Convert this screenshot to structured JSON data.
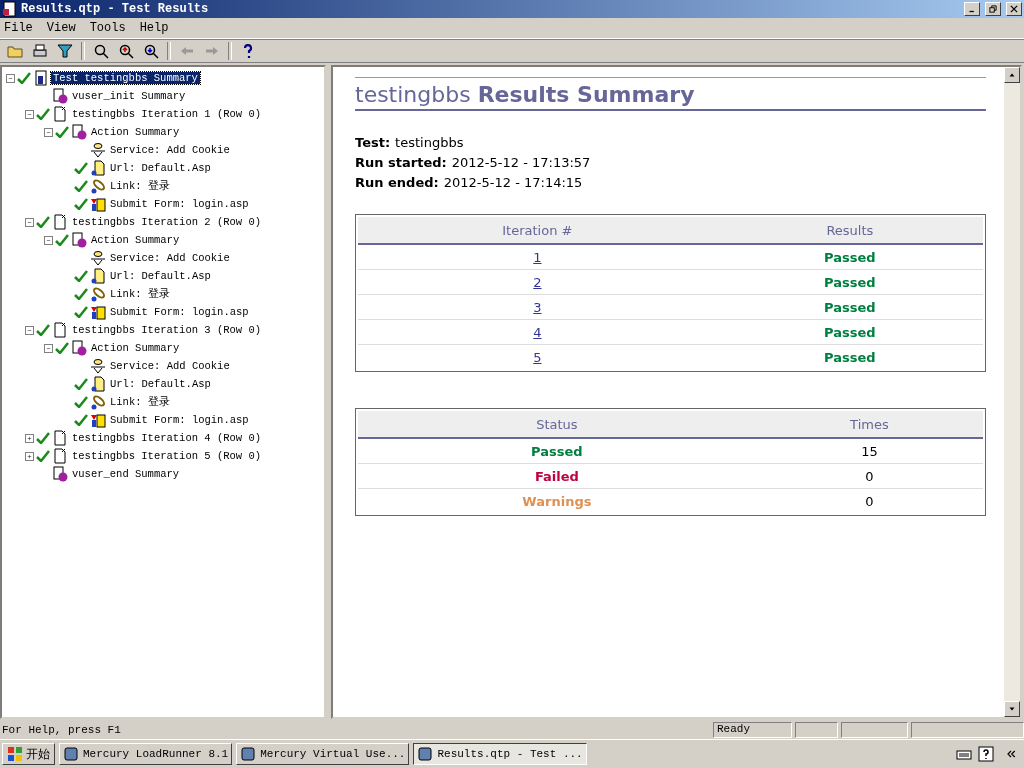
{
  "window": {
    "title": "Results.qtp - Test Results"
  },
  "menu": [
    "File",
    "View",
    "Tools",
    "Help"
  ],
  "tree": [
    {
      "label": "Test testingbbs Summary",
      "kind": "test",
      "passed": true,
      "selected": true,
      "expanded": true,
      "children": [
        {
          "label": "vuser_init Summary",
          "kind": "action",
          "passed": false,
          "selected": false
        },
        {
          "label": "testingbbs Iteration 1 (Row 0)",
          "kind": "iteration",
          "passed": true,
          "selected": false,
          "expanded": true,
          "children": [
            {
              "label": "Action Summary",
              "kind": "action",
              "passed": true,
              "selected": false,
              "expanded": true,
              "children": [
                {
                  "label": "Service: Add Cookie",
                  "kind": "service",
                  "passed": false,
                  "selected": false
                },
                {
                  "label": "Url: Default.Asp",
                  "kind": "url",
                  "passed": true,
                  "selected": false
                },
                {
                  "label": "Link: 登录",
                  "kind": "link",
                  "passed": true,
                  "selected": false
                },
                {
                  "label": "Submit Form: login.asp",
                  "kind": "form",
                  "passed": true,
                  "selected": false
                }
              ]
            }
          ]
        },
        {
          "label": "testingbbs Iteration 2 (Row 0)",
          "kind": "iteration",
          "passed": true,
          "selected": false,
          "expanded": true,
          "children": [
            {
              "label": "Action Summary",
              "kind": "action",
              "passed": true,
              "selected": false,
              "expanded": true,
              "children": [
                {
                  "label": "Service: Add Cookie",
                  "kind": "service",
                  "passed": false,
                  "selected": false
                },
                {
                  "label": "Url: Default.Asp",
                  "kind": "url",
                  "passed": true,
                  "selected": false
                },
                {
                  "label": "Link: 登录",
                  "kind": "link",
                  "passed": true,
                  "selected": false
                },
                {
                  "label": "Submit Form: login.asp",
                  "kind": "form",
                  "passed": true,
                  "selected": false
                }
              ]
            }
          ]
        },
        {
          "label": "testingbbs Iteration 3 (Row 0)",
          "kind": "iteration",
          "passed": true,
          "selected": false,
          "expanded": true,
          "children": [
            {
              "label": "Action Summary",
              "kind": "action",
              "passed": true,
              "selected": false,
              "expanded": true,
              "children": [
                {
                  "label": "Service: Add Cookie",
                  "kind": "service",
                  "passed": false,
                  "selected": false
                },
                {
                  "label": "Url: Default.Asp",
                  "kind": "url",
                  "passed": true,
                  "selected": false
                },
                {
                  "label": "Link: 登录",
                  "kind": "link",
                  "passed": true,
                  "selected": false
                },
                {
                  "label": "Submit Form: login.asp",
                  "kind": "form",
                  "passed": true,
                  "selected": false
                }
              ]
            }
          ]
        },
        {
          "label": "testingbbs Iteration 4 (Row 0)",
          "kind": "iteration",
          "passed": true,
          "selected": false,
          "expanded": false
        },
        {
          "label": "testingbbs Iteration 5 (Row 0)",
          "kind": "iteration",
          "passed": true,
          "selected": false,
          "expanded": false
        },
        {
          "label": "vuser_end Summary",
          "kind": "action",
          "passed": false,
          "selected": false
        }
      ]
    }
  ],
  "report": {
    "title": "testingbbs **Results Summary**",
    "info": [
      {
        "label": "Test:",
        "value": "testingbbs"
      },
      {
        "label": "Run started:",
        "value": "2012-5-12 - 17:13:57"
      },
      {
        "label": "Run ended:",
        "value": "2012-5-12 - 17:14:15"
      }
    ],
    "iterations": {
      "columns": [
        "Iteration #",
        "Results"
      ],
      "rows": [
        {
          "iteration": "1",
          "result": "Passed"
        },
        {
          "iteration": "2",
          "result": "Passed"
        },
        {
          "iteration": "3",
          "result": "Passed"
        },
        {
          "iteration": "4",
          "result": "Passed"
        },
        {
          "iteration": "5",
          "result": "Passed"
        }
      ]
    },
    "status": {
      "columns": [
        "Status",
        "Times"
      ],
      "rows": [
        {
          "status": "Passed",
          "kind": "passed",
          "times": "15"
        },
        {
          "status": "Failed",
          "kind": "failed",
          "times": "0"
        },
        {
          "status": "Warnings",
          "kind": "warnings",
          "times": "0"
        }
      ]
    }
  },
  "status_bar": {
    "help": "For Help, press F1",
    "state": "Ready"
  },
  "taskbar": {
    "start": "开始",
    "tasks": [
      {
        "label": "Mercury LoadRunner 8.1",
        "selected": false
      },
      {
        "label": "Mercury Virtual Use...",
        "selected": false
      },
      {
        "label": "Results.qtp - Test ...",
        "selected": true
      }
    ]
  }
}
